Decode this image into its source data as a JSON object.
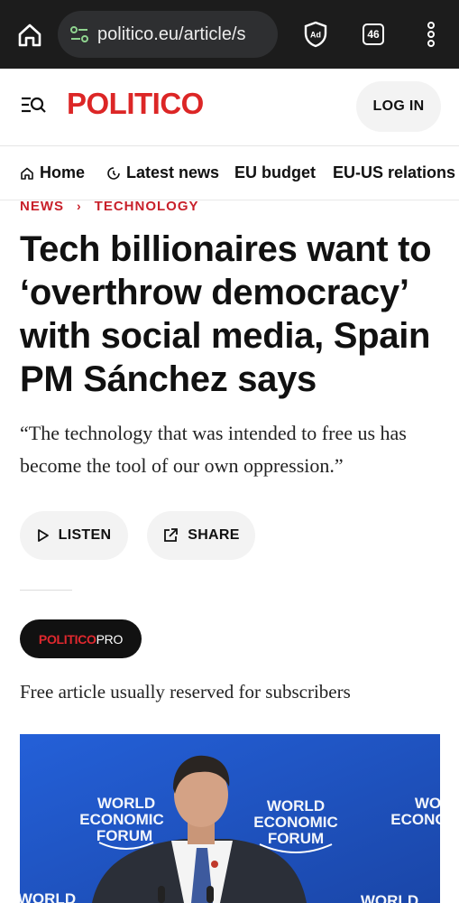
{
  "browser": {
    "url": "politico.eu/article/s",
    "tab_count": "46",
    "adblock_label": "Ad"
  },
  "header": {
    "logo": "POLITICO",
    "login_label": "LOG IN"
  },
  "nav": {
    "items": [
      {
        "label": "Home"
      },
      {
        "label": "Latest news"
      },
      {
        "label": "EU budget"
      },
      {
        "label": "EU-US relations"
      }
    ]
  },
  "article": {
    "breadcrumb": {
      "section": "NEWS",
      "subsection": "TECHNOLOGY"
    },
    "headline": "Tech billionaires want to ‘overthrow democracy’ with social media, Spain PM Sánchez says",
    "dek": "“The technology that was intended to free us has become the tool of our own oppression.”",
    "listen_label": "LISTEN",
    "share_label": "SHARE",
    "pro_badge": {
      "part1": "POLITICO",
      "part2": "PRO"
    },
    "free_note": "Free article usually reserved for subscribers",
    "hero_image": {
      "backdrop_texts": [
        "WORLD",
        "ECONOMIC",
        "FORUM"
      ]
    }
  },
  "colors": {
    "brand_red": "#dc2626",
    "breadcrumb_red": "#c8202a",
    "hero_blue": "#1f4fb8"
  }
}
